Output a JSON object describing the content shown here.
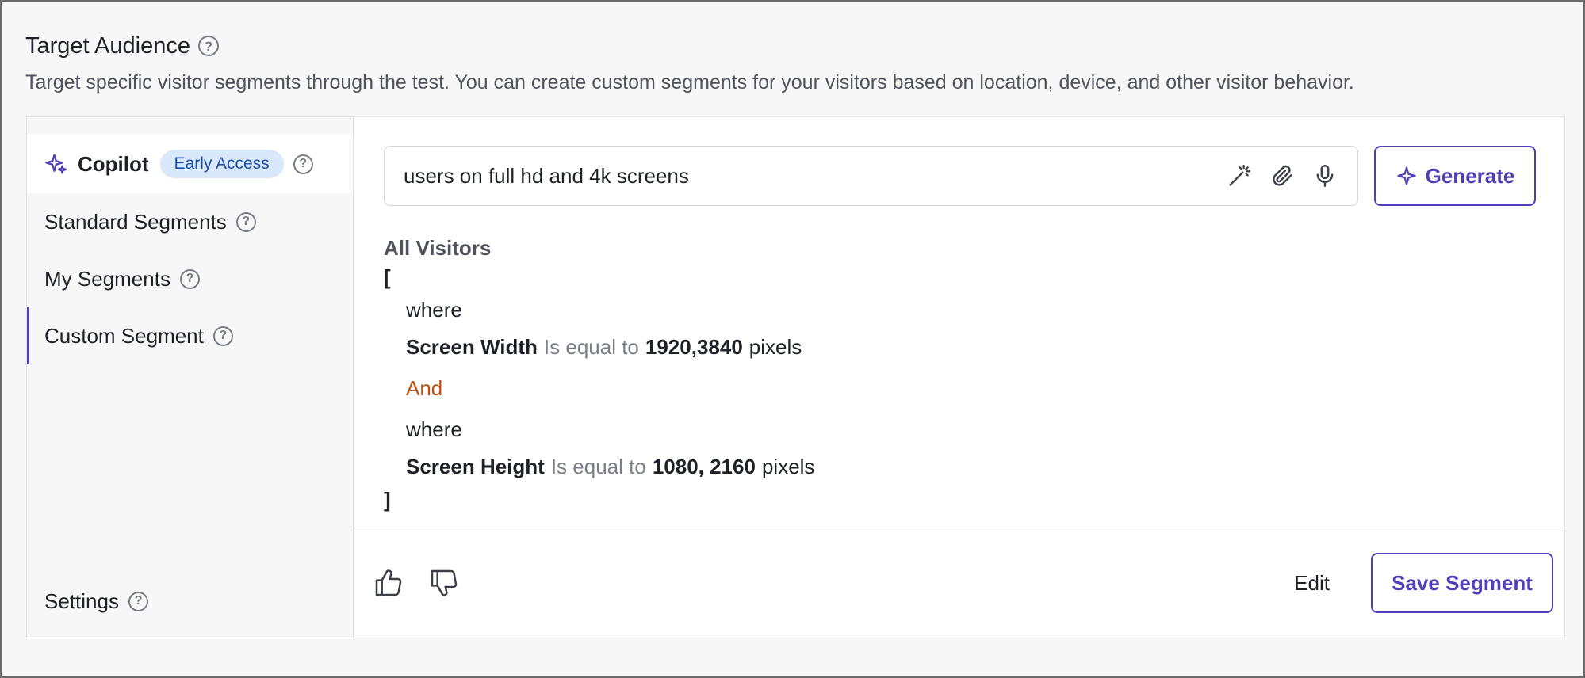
{
  "header": {
    "title": "Target Audience",
    "description": "Target specific visitor segments through the test. You can create custom segments for your visitors based on location, device, and other visitor behavior."
  },
  "sidebar": {
    "copilot": {
      "label": "Copilot",
      "badge": "Early Access",
      "icon": "sparkles-icon"
    },
    "items": [
      {
        "label": "Standard Segments"
      },
      {
        "label": "My Segments"
      },
      {
        "label": "Custom Segment",
        "active": true
      }
    ],
    "settings": {
      "label": "Settings"
    }
  },
  "prompt": {
    "value": "users on full hd and 4k screens",
    "icons": [
      "magic-wand-icon",
      "paperclip-icon",
      "microphone-icon"
    ],
    "generate_label": "Generate"
  },
  "segment": {
    "title": "All Visitors",
    "open_bracket": "[",
    "close_bracket": "]",
    "conditions": [
      {
        "keyword": "where",
        "field": "Screen Width",
        "operator": "Is equal to",
        "value": "1920,3840",
        "unit": "pixels"
      },
      {
        "keyword": "where",
        "field": "Screen Height",
        "operator": "Is equal to",
        "value": "1080, 2160",
        "unit": "pixels"
      }
    ],
    "joiner": "And"
  },
  "footer": {
    "edit_label": "Edit",
    "save_label": "Save Segment"
  },
  "colors": {
    "accent": "#4f3fb8",
    "badge_bg": "#d9e9fb",
    "badge_text": "#1e4fa8",
    "joiner": "#c14e0f"
  }
}
